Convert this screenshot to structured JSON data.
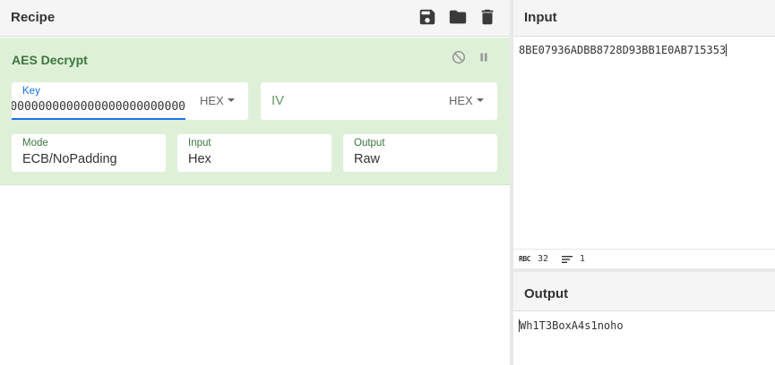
{
  "recipe": {
    "title": "Recipe",
    "icons": [
      "save-icon",
      "folder-icon",
      "trash-icon"
    ]
  },
  "operation": {
    "name": "AES Decrypt",
    "controls": [
      "disable-icon",
      "pause-icon"
    ],
    "key": {
      "label": "Key",
      "value": "0000000000000000000000000000000",
      "format": "HEX"
    },
    "iv": {
      "placeholder": "IV",
      "format": "HEX"
    },
    "mode": {
      "label": "Mode",
      "value": "ECB/NoPadding"
    },
    "input": {
      "label": "Input",
      "value": "Hex"
    },
    "output": {
      "label": "Output",
      "value": "Raw"
    }
  },
  "input_panel": {
    "title": "Input",
    "text": "8BE07936ADBB8728D93BB1E0AB715353",
    "status": {
      "length_icon": "RBC",
      "length": "32",
      "lines": "1"
    }
  },
  "output_panel": {
    "title": "Output",
    "text": "Wh1T3BoxA4s1noho"
  },
  "colors": {
    "op_background": "#dff0d8",
    "op_title": "#3c763d",
    "focus_blue": "#1a73e8",
    "header_bg": "#f5f5f5"
  }
}
